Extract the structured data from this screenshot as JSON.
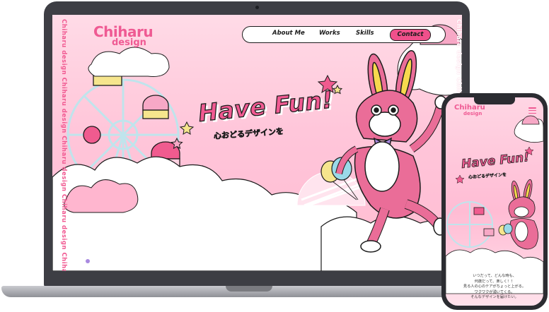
{
  "site": {
    "brand_line1": "Chiharu",
    "brand_line2": "design",
    "side_text": "Chiharu design  Chiharu design  Chiharu design  Chiharu design  Chiharu design",
    "nav": [
      {
        "label": "About Me"
      },
      {
        "label": "Works"
      },
      {
        "label": "Skills"
      },
      {
        "label": "Contact"
      }
    ],
    "hero_title": "Have Fun!",
    "hero_subtitle": "心おどるデザインを"
  },
  "mobile": {
    "brand_line1": "Chiharu",
    "brand_line2": "design",
    "hero_title": "Have Fun!",
    "hero_subtitle": "心おどるデザインを",
    "copy": [
      "いつだって、どんな時も、",
      "何歳だって、楽しく！！",
      "見る人の心のテアがちょっと上がる。",
      "ワクワクが湧いてくる。",
      "そんなデザインを届けたい。"
    ]
  },
  "colors": {
    "accent": "#f15a92",
    "bg_pink": "#ffc4d8",
    "bunny": "#ea6d98",
    "ear_inner": "#f7d94e",
    "bow": "#a889e0",
    "device": "#3d3e44"
  }
}
